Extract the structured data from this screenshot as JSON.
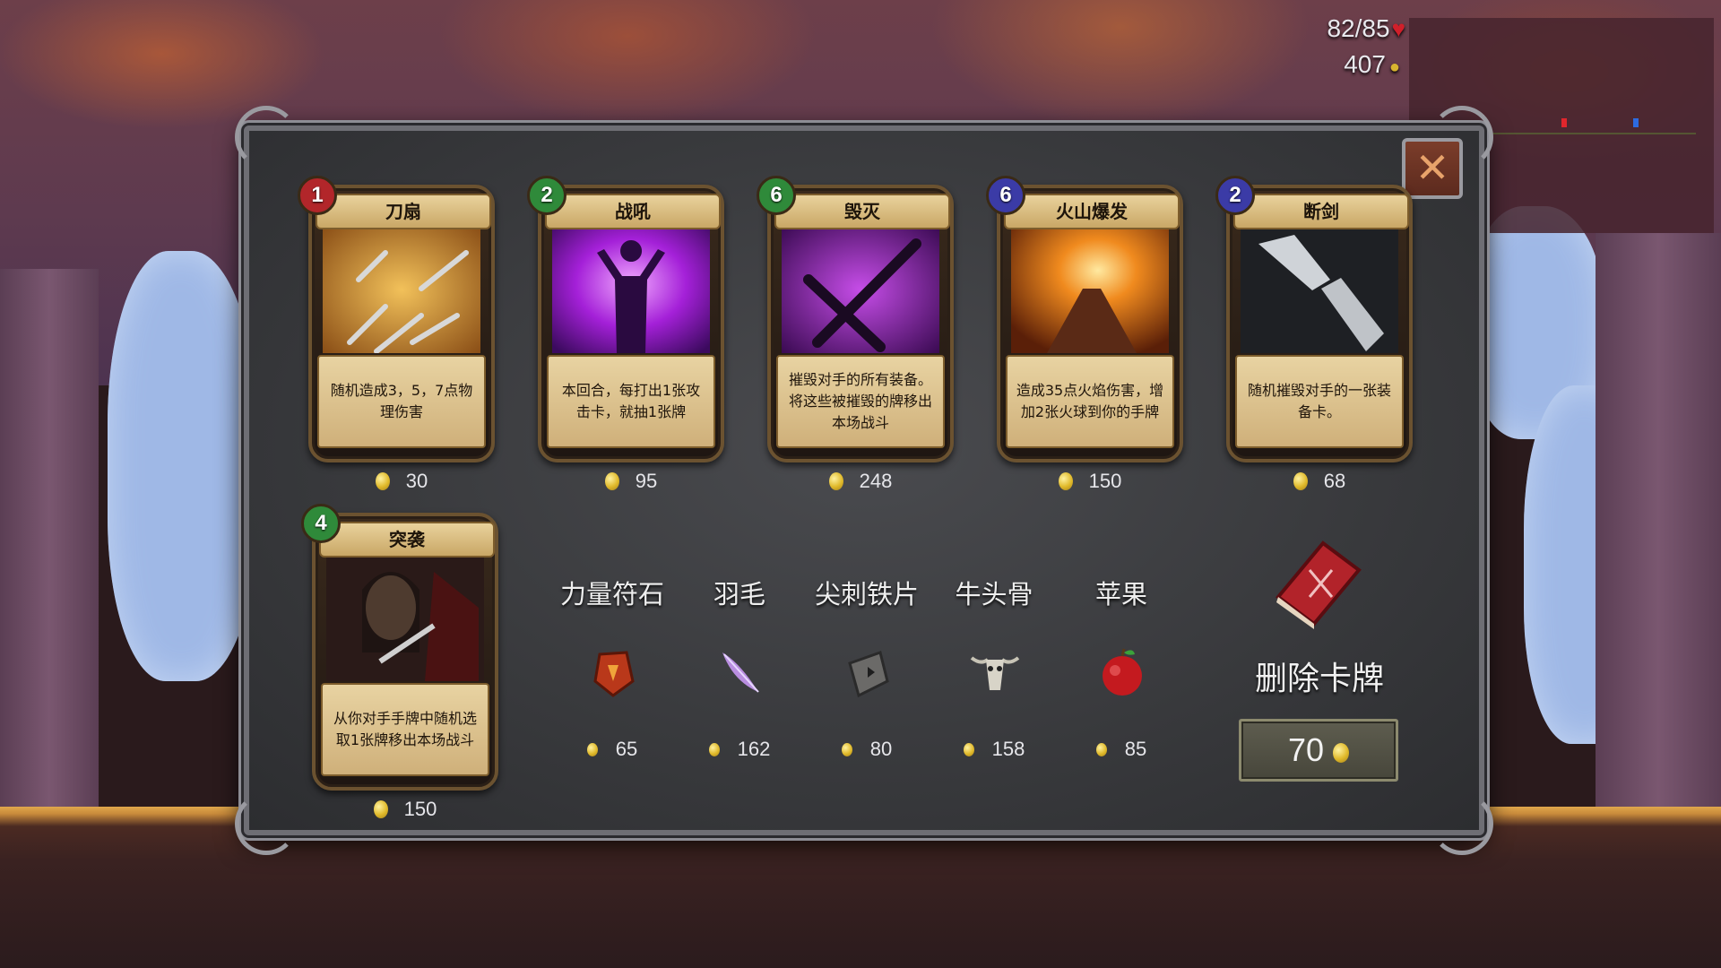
{
  "hud": {
    "hp": "82/85",
    "gold": "407"
  },
  "cards": [
    {
      "cost": "1",
      "cost_color": "#b2262a",
      "title": "刀扇",
      "desc": "随机造成3，5，7点物理伤害",
      "price": "30",
      "art": "throwing-knives"
    },
    {
      "cost": "2",
      "cost_color": "#2f8a3a",
      "title": "战吼",
      "desc": "本回合，每打出1张攻击卡，就抽1张牌",
      "price": "95",
      "art": "war-cry-silhouette"
    },
    {
      "cost": "6",
      "cost_color": "#2f8a3a",
      "title": "毁灭",
      "desc": "摧毁对手的所有装备。将这些被摧毁的牌移出本场战斗",
      "price": "248",
      "art": "crossed-swords"
    },
    {
      "cost": "6",
      "cost_color": "#3b3ba6",
      "title": "火山爆发",
      "desc": "造成35点火焰伤害，增加2张火球到你的手牌",
      "price": "150",
      "art": "volcano"
    },
    {
      "cost": "2",
      "cost_color": "#3b3ba6",
      "title": "断剑",
      "desc": "随机摧毁对手的一张装备卡。",
      "price": "68",
      "art": "broken-sword"
    },
    {
      "cost": "4",
      "cost_color": "#2f8a3a",
      "title": "突袭",
      "desc": "从你对手手牌中随机选取1张牌移出本场战斗",
      "price": "150",
      "art": "assassin"
    }
  ],
  "items": [
    {
      "name": "力量符石",
      "price": "65",
      "icon": "rune-stone-icon"
    },
    {
      "name": "羽毛",
      "price": "162",
      "icon": "feather-icon"
    },
    {
      "name": "尖刺铁片",
      "price": "80",
      "icon": "spiked-plate-icon"
    },
    {
      "name": "牛头骨",
      "price": "158",
      "icon": "bull-skull-icon"
    },
    {
      "name": "苹果",
      "price": "85",
      "icon": "apple-icon"
    }
  ],
  "remove": {
    "label": "删除卡牌",
    "price": "70"
  }
}
